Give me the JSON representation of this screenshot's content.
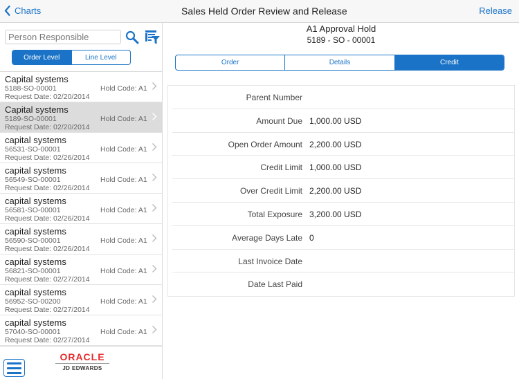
{
  "header": {
    "back_label": "Charts",
    "title": "Sales Held Order Review and Release",
    "release_label": "Release"
  },
  "sidebar": {
    "search_placeholder": "Person Responsible",
    "segments": [
      {
        "label": "Order Level",
        "active": true
      },
      {
        "label": "Line Level",
        "active": false
      }
    ],
    "items": [
      {
        "name": "Capital systems",
        "number": "5188-SO-00001",
        "date": "Request Date: 02/20/2014",
        "hold": "Hold Code: A1",
        "selected": false
      },
      {
        "name": "Capital systems",
        "number": "5189-SO-00001",
        "date": "Request Date: 02/20/2014",
        "hold": "Hold Code: A1",
        "selected": true
      },
      {
        "name": "capital systems",
        "number": "56531-SO-00001",
        "date": "Request Date: 02/26/2014",
        "hold": "Hold Code: A1",
        "selected": false
      },
      {
        "name": "capital systems",
        "number": "56549-SO-00001",
        "date": "Request Date: 02/26/2014",
        "hold": "Hold Code: A1",
        "selected": false
      },
      {
        "name": "capital systems",
        "number": "56581-SO-00001",
        "date": "Request Date: 02/26/2014",
        "hold": "Hold Code: A1",
        "selected": false
      },
      {
        "name": "capital systems",
        "number": "56590-SO-00001",
        "date": "Request Date: 02/26/2014",
        "hold": "Hold Code: A1",
        "selected": false
      },
      {
        "name": "capital systems",
        "number": "56821-SO-00001",
        "date": "Request Date: 02/27/2014",
        "hold": "Hold Code: A1",
        "selected": false
      },
      {
        "name": "capital systems",
        "number": "56952-SO-00200",
        "date": "Request Date: 02/27/2014",
        "hold": "Hold Code: A1",
        "selected": false
      },
      {
        "name": "capital systems",
        "number": "57040-SO-00001",
        "date": "Request Date: 02/27/2014",
        "hold": "Hold Code: A1",
        "selected": false
      }
    ],
    "logo": {
      "brand": "ORACLE",
      "product": "JD EDWARDS"
    }
  },
  "main": {
    "hold_title": "A1 Approval Hold",
    "order_number": "5189 - SO - 00001",
    "tabs": [
      {
        "label": "Order",
        "active": false
      },
      {
        "label": "Details",
        "active": false
      },
      {
        "label": "Credit",
        "active": true
      }
    ],
    "fields": [
      {
        "label": "Parent Number",
        "value": ""
      },
      {
        "label": "Amount Due",
        "value": "1,000.00 USD"
      },
      {
        "label": "Open Order Amount",
        "value": "2,200.00 USD"
      },
      {
        "label": "Credit Limit",
        "value": "1,000.00 USD"
      },
      {
        "label": "Over Credit Limit",
        "value": "2,200.00 USD"
      },
      {
        "label": "Total Exposure",
        "value": "3,200.00 USD"
      },
      {
        "label": "Average Days Late",
        "value": "0"
      },
      {
        "label": "Last Invoice Date",
        "value": ""
      },
      {
        "label": "Date Last Paid",
        "value": ""
      }
    ]
  },
  "colors": {
    "accent": "#1a73c7",
    "selected_row": "#dcdcdc",
    "oracle_red": "#e42b2b"
  }
}
